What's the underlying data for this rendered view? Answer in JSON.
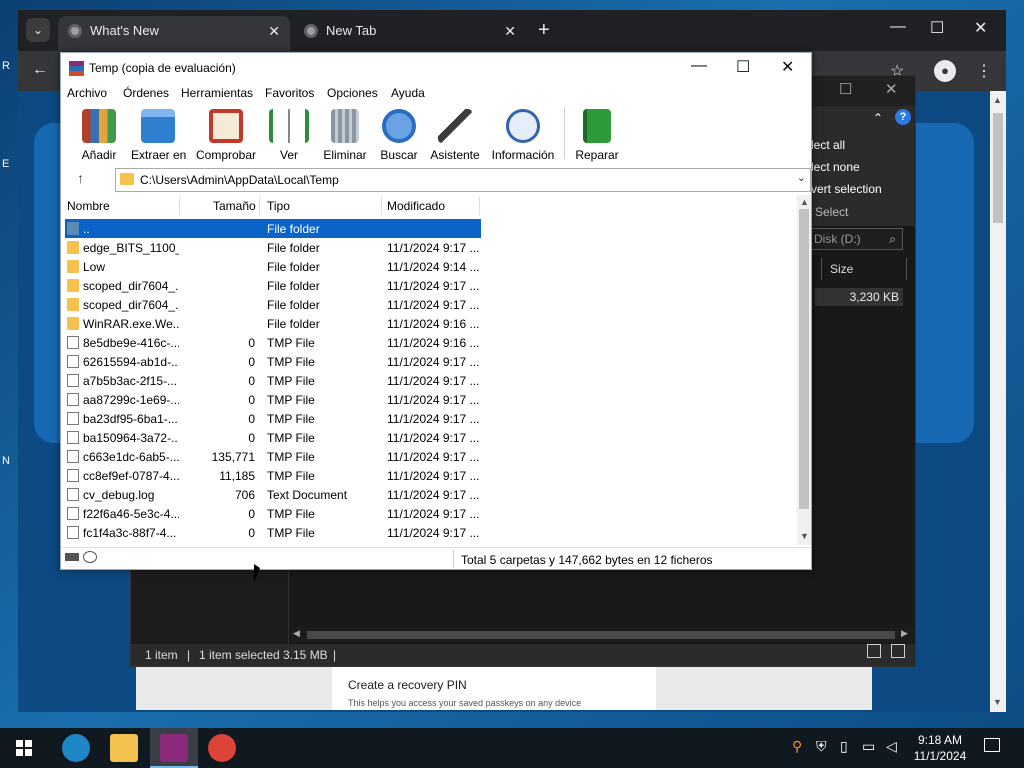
{
  "browser": {
    "tabs": [
      {
        "label": "What's New",
        "close": "✕"
      },
      {
        "label": "New Tab",
        "close": "✕"
      }
    ],
    "new_tab": "+",
    "controls": {
      "minimize": "—",
      "maximize": "☐",
      "close": "✕"
    }
  },
  "explorer": {
    "ribbon": [
      "lect all",
      "lect none",
      "vert selection"
    ],
    "select_label": "Select",
    "search_placeholder": "Disk (D:)",
    "column": "Size",
    "size_value": "3,230 KB",
    "status": {
      "items": "1 item",
      "selected": "1 item selected",
      "size": "3.15 MB"
    }
  },
  "recovery": {
    "title": "Create a recovery PIN",
    "subtitle": "This helps you access your saved passkeys on any device"
  },
  "winrar": {
    "title": "Temp (copia de evaluación)",
    "menu": [
      "Archivo",
      "Órdenes",
      "Herramientas",
      "Favoritos",
      "Opciones",
      "Ayuda"
    ],
    "toolbar": [
      {
        "label": "Añadir",
        "icon": "add-books-icon",
        "color": "#b0402a"
      },
      {
        "label": "Extraer en",
        "icon": "extract-folder-icon",
        "color": "#2f7fd0"
      },
      {
        "label": "Comprobar",
        "icon": "clipboard-check-icon",
        "color": "#c0392b"
      },
      {
        "label": "Ver",
        "icon": "open-book-icon",
        "color": "#2e8b3c"
      },
      {
        "label": "Eliminar",
        "icon": "trash-bin-icon",
        "color": "#8a96a3"
      },
      {
        "label": "Buscar",
        "icon": "magnifier-icon",
        "color": "#2d6cc0"
      },
      {
        "label": "Asistente",
        "icon": "magic-wand-icon",
        "color": "#7a8d9a"
      },
      {
        "label": "Información",
        "icon": "info-icon",
        "color": "#3264b0"
      },
      {
        "label": "Reparar",
        "icon": "repair-book-icon",
        "color": "#2f9a3a"
      }
    ],
    "path": "C:\\Users\\Admin\\AppData\\Local\\Temp",
    "columns": {
      "name": "Nombre",
      "size": "Tamaño",
      "type": "Tipo",
      "modified": "Modificado"
    },
    "rows": [
      {
        "name": "..",
        "size": "",
        "type": "File folder",
        "modified": "",
        "kind": "parent"
      },
      {
        "name": "edge_BITS_1100_...",
        "size": "",
        "type": "File folder",
        "modified": "11/1/2024 9:17 ...",
        "kind": "folder"
      },
      {
        "name": "Low",
        "size": "",
        "type": "File folder",
        "modified": "11/1/2024 9:14 ...",
        "kind": "folder"
      },
      {
        "name": "scoped_dir7604_...",
        "size": "",
        "type": "File folder",
        "modified": "11/1/2024 9:17 ...",
        "kind": "folder"
      },
      {
        "name": "scoped_dir7604_...",
        "size": "",
        "type": "File folder",
        "modified": "11/1/2024 9:17 ...",
        "kind": "folder"
      },
      {
        "name": "WinRAR.exe.We...",
        "size": "",
        "type": "File folder",
        "modified": "11/1/2024 9:16 ...",
        "kind": "folder"
      },
      {
        "name": "8e5dbe9e-416c-...",
        "size": "0",
        "type": "TMP File",
        "modified": "11/1/2024 9:16 ...",
        "kind": "file"
      },
      {
        "name": "62615594-ab1d-...",
        "size": "0",
        "type": "TMP File",
        "modified": "11/1/2024 9:17 ...",
        "kind": "file"
      },
      {
        "name": "a7b5b3ac-2f15-...",
        "size": "0",
        "type": "TMP File",
        "modified": "11/1/2024 9:17 ...",
        "kind": "file"
      },
      {
        "name": "aa87299c-1e69-...",
        "size": "0",
        "type": "TMP File",
        "modified": "11/1/2024 9:17 ...",
        "kind": "file"
      },
      {
        "name": "ba23df95-6ba1-...",
        "size": "0",
        "type": "TMP File",
        "modified": "11/1/2024 9:17 ...",
        "kind": "file"
      },
      {
        "name": "ba150964-3a72-...",
        "size": "0",
        "type": "TMP File",
        "modified": "11/1/2024 9:17 ...",
        "kind": "file"
      },
      {
        "name": "c663e1dc-6ab5-...",
        "size": "135,771",
        "type": "TMP File",
        "modified": "11/1/2024 9:17 ...",
        "kind": "file"
      },
      {
        "name": "cc8ef9ef-0787-4...",
        "size": "11,185",
        "type": "TMP File",
        "modified": "11/1/2024 9:17 ...",
        "kind": "file"
      },
      {
        "name": "cv_debug.log",
        "size": "706",
        "type": "Text Document",
        "modified": "11/1/2024 9:17 ...",
        "kind": "file"
      },
      {
        "name": "f22f6a46-5e3c-4...",
        "size": "0",
        "type": "TMP File",
        "modified": "11/1/2024 9:17 ...",
        "kind": "file"
      },
      {
        "name": "fc1f4a3c-88f7-4...",
        "size": "0",
        "type": "TMP File",
        "modified": "11/1/2024 9:17 ...",
        "kind": "file"
      }
    ],
    "status": "Total 5 carpetas y 147,662 bytes en 12 ficheros"
  },
  "taskbar": {
    "apps": [
      {
        "name": "edge",
        "color": "#1e88c7"
      },
      {
        "name": "file-explorer",
        "color": "#f2c14e"
      },
      {
        "name": "winrar",
        "color": "#8b2a7d"
      },
      {
        "name": "chrome",
        "color": "#db4437"
      }
    ],
    "time": "9:18 AM",
    "date": "11/1/2024"
  }
}
